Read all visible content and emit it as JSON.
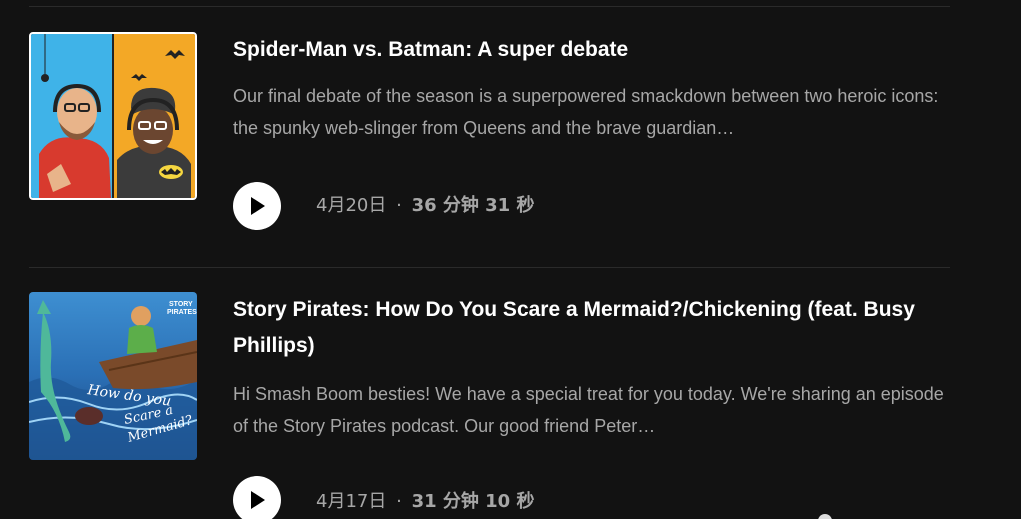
{
  "episodes": [
    {
      "title": "Spider-Man vs. Batman: A super debate",
      "description": "Our final debate of the season is a superpowered smackdown between two heroic icons: the spunky web-slinger from Queens and the brave guardian…",
      "date": "4月20日",
      "separator": "·",
      "duration": "36 分钟 31 秒",
      "cover_icon": "podcast-hosts-cover-art",
      "selected": true
    },
    {
      "title": "Story Pirates: How Do You Scare a Mermaid?/Chickening (feat. Busy Phillips)",
      "description": "Hi Smash Boom besties! We have a special treat for you today. We're sharing an episode of the Story Pirates podcast. Our good friend Peter…",
      "date": "4月17日",
      "separator": "·",
      "duration": "31 分钟 10 秒",
      "cover_icon": "mermaid-cover-art",
      "cover_text": "How do you Scare a Mermaid?",
      "selected": false
    }
  ],
  "colors": {
    "background": "#121212",
    "title": "#ffffff",
    "secondary_text": "#a7a7a7",
    "divider": "#2a2a2a",
    "play_button": "#ffffff"
  }
}
